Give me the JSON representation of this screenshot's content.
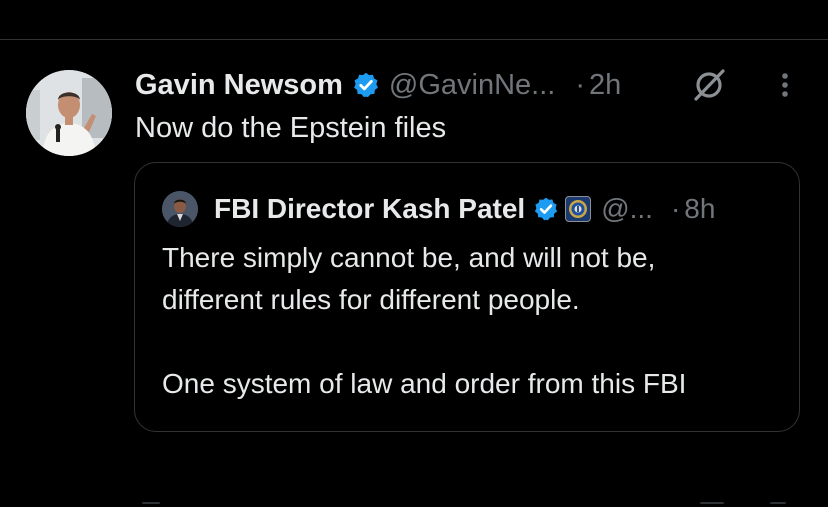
{
  "post": {
    "author_name": "Gavin Newsom",
    "author_handle": "@GavinNe...",
    "separator": "·",
    "time": "2h",
    "text": "Now do the Epstein files",
    "avatar_icon": "person-avatar",
    "verified_icon": "verified-badge-icon",
    "grok_icon": "grok-icon",
    "more_icon": "more-vertical-icon"
  },
  "quote": {
    "author_name": "FBI Director Kash Patel",
    "author_handle": "@...",
    "separator": "·",
    "time": "8h",
    "text_lines": [
      "There simply cannot be, and will not be,",
      "different rules for different people.",
      "",
      "One system of law and order from this FBI"
    ],
    "verified_icon": "verified-badge-icon",
    "affiliation_icon": "fbi-seal-icon"
  },
  "colors": {
    "background": "#000000",
    "text_primary": "#e7e9ea",
    "text_secondary": "#71767b",
    "border": "#2f3336",
    "verified_blue": "#1d9bf0"
  }
}
